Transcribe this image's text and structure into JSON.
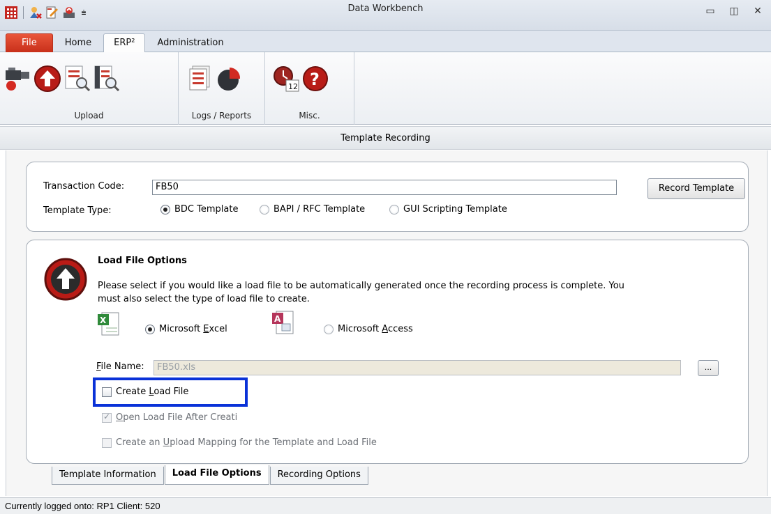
{
  "window": {
    "title": "Data Workbench"
  },
  "ribbon_tabs": [
    "File",
    "Home",
    "ERP²",
    "Administration"
  ],
  "ribbon_groups": [
    {
      "label": "Upload"
    },
    {
      "label": "Logs / Reports"
    },
    {
      "label": "Misc."
    }
  ],
  "section_title": "Template Recording",
  "template": {
    "transaction_code_label": "Transaction Code:",
    "transaction_code_value": "FB50",
    "record_button": "Record Template",
    "template_type_label": "Template Type:",
    "options": [
      "BDC Template",
      "BAPI / RFC Template",
      "GUI Scripting Template"
    ],
    "selected": "BDC Template"
  },
  "load_file": {
    "heading": "Load File Options",
    "description_line1": "Please select if you would like a load file to be automatically generated once the recording process is complete. You",
    "description_line2": "must also select the type of load file to create.",
    "excel_label_pre": "Microsoft ",
    "excel_label_key": "E",
    "excel_label_post": "xcel",
    "access_label_pre": "Microsoft ",
    "access_label_key": "A",
    "access_label_post": "ccess",
    "file_name_label_key": "F",
    "file_name_label_post": "ile Name:",
    "file_name_value": "FB50.xls",
    "browse_label": "...",
    "create_load_pre": "Create ",
    "create_load_key": "L",
    "create_load_post": "oad File",
    "open_after_key": "O",
    "open_after_post": "pen Load File After Creati",
    "mapping_pre": "Create an ",
    "mapping_key": "U",
    "mapping_post": "pload Mapping for the Template and Load File"
  },
  "bottom_tabs": [
    "Template Information",
    "Load File Options",
    "Recording Options"
  ],
  "status": {
    "text": "Currently logged onto: RP1 Client: 520"
  },
  "colors": {
    "file_tab": "#d43f25",
    "highlight": "#0a32d8",
    "icon_red": "#c8251f"
  }
}
